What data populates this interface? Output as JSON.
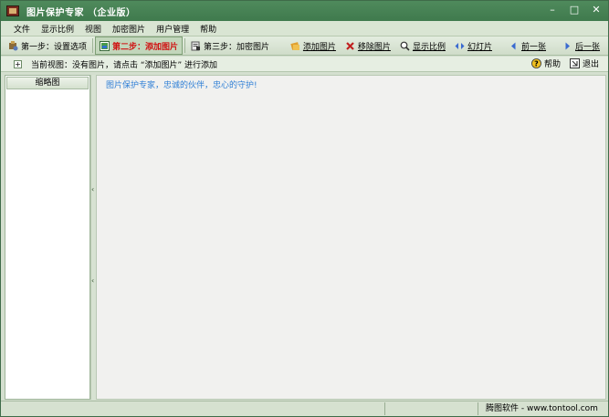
{
  "window": {
    "title": "图片保护专家 （企业版）",
    "controls": {
      "minimize": "–",
      "maximize": "□",
      "close": "✕"
    }
  },
  "menu": [
    "文件",
    "显示比例",
    "视图",
    "加密图片",
    "用户管理",
    "帮助"
  ],
  "steps": [
    {
      "label": "第一步：设置选项",
      "icon": "settings-tools-icon",
      "active": false
    },
    {
      "label": "第二步：添加图片",
      "icon": "add-picture-icon",
      "active": true
    },
    {
      "label": "第三步：加密图片",
      "icon": "encrypt-icon",
      "active": false
    }
  ],
  "toolbar_actions": [
    {
      "label": "添加图片",
      "icon": "add-image-icon"
    },
    {
      "label": "移除图片",
      "icon": "remove-x-icon"
    },
    {
      "label": "显示比例",
      "icon": "zoom-icon"
    },
    {
      "label": "幻灯片",
      "icon": "slideshow-icon"
    },
    {
      "label": "前一张",
      "icon": "prev-arrow-icon"
    },
    {
      "label": "后一张",
      "icon": "next-arrow-icon"
    }
  ],
  "infobar": {
    "expand_symbol": "+",
    "view_text": "当前视图：没有图片，请点击 “添加图片” 进行添加",
    "help_label": "帮助",
    "exit_label": "退出"
  },
  "left_panel": {
    "tab_label": "缩略图"
  },
  "main": {
    "message": "图片保护专家，忠诚的伙伴，忠心的守护!"
  },
  "statusbar": {
    "vendor": "腾图软件 - www.tontool.com"
  },
  "colors": {
    "titlebar": "#4a845a",
    "active_step_text": "#d01010",
    "message_text": "#2f7fd6",
    "window_bg": "#d4dfcf"
  }
}
